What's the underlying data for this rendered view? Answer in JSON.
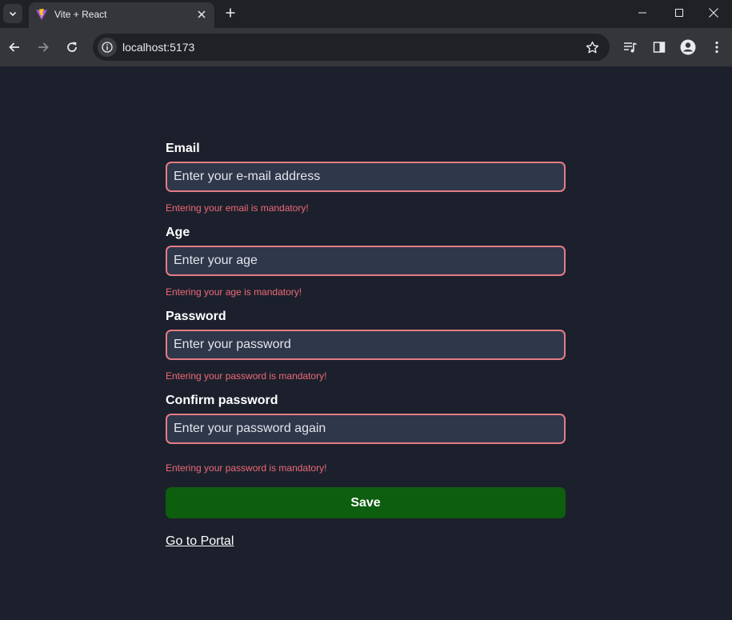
{
  "browser": {
    "tab_title": "Vite + React",
    "url": "localhost:5173",
    "icons": {
      "tab_search": "chevron-down-icon",
      "favicon": "vite-logo-icon",
      "tab_close": "close-icon",
      "new_tab": "plus-icon",
      "minimize": "minimize-icon",
      "maximize": "maximize-icon",
      "window_close": "close-icon",
      "back": "arrow-left-icon",
      "forward": "arrow-right-icon",
      "reload": "reload-icon",
      "site_info": "info-icon",
      "bookmark": "star-icon",
      "media": "media-control-icon",
      "side_panel": "side-panel-icon",
      "profile": "profile-icon",
      "menu": "kebab-menu-icon"
    }
  },
  "form": {
    "fields": [
      {
        "label": "Email",
        "placeholder": "Enter your e-mail address",
        "value": "",
        "error": "Entering your email is mandatory!"
      },
      {
        "label": "Age",
        "placeholder": "Enter your age",
        "value": "",
        "error": "Entering your age is mandatory!"
      },
      {
        "label": "Password",
        "placeholder": "Enter your password",
        "value": "",
        "error": "Entering your password is mandatory!"
      },
      {
        "label": "Confirm password",
        "placeholder": "Enter your password again",
        "value": "",
        "error": "Entering your password is mandatory!"
      }
    ],
    "save_label": "Save",
    "portal_link": "Go to Portal"
  },
  "colors": {
    "page_background": "#1b202c",
    "input_background": "#2f374b",
    "input_border": "#e57b84",
    "error_text": "#f06a78",
    "save_button": "#0d5e0f"
  }
}
